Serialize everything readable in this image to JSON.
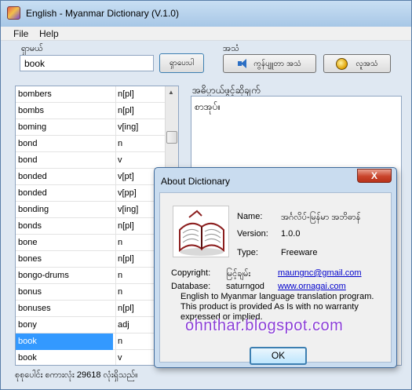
{
  "window": {
    "title": "English - Myanmar Dictionary (V.1.0)"
  },
  "menu": {
    "file": "File",
    "help": "Help"
  },
  "search": {
    "group_label": "ရှာမယ်",
    "value": "book",
    "button_label": "ရှာပေးပါ"
  },
  "sound": {
    "group_label": "အသံ",
    "speak_button_label": "ကွန်ပျူတာ အသံ",
    "human_button_label": "လူအသံ"
  },
  "meaning": {
    "label": "အဓိပ္ပာယ်ဖွင့်ဆိုချက်",
    "text": "စာအုပ်။"
  },
  "word_list": {
    "rows": [
      {
        "word": "bombers",
        "pos": "n[pl]"
      },
      {
        "word": "bombs",
        "pos": "n[pl]"
      },
      {
        "word": "boming",
        "pos": "v[ing]"
      },
      {
        "word": "bond",
        "pos": "n"
      },
      {
        "word": "bond",
        "pos": "v"
      },
      {
        "word": "bonded",
        "pos": "v[pt]"
      },
      {
        "word": "bonded",
        "pos": "v[pp]"
      },
      {
        "word": "bonding",
        "pos": "v[ing]"
      },
      {
        "word": "bonds",
        "pos": "n[pl]"
      },
      {
        "word": "bone",
        "pos": "n"
      },
      {
        "word": "bones",
        "pos": "n[pl]"
      },
      {
        "word": "bongo-drums",
        "pos": "n"
      },
      {
        "word": "bonus",
        "pos": "n"
      },
      {
        "word": "bonuses",
        "pos": "n[pl]"
      },
      {
        "word": "bony",
        "pos": "adj"
      },
      {
        "word": "book",
        "pos": "n"
      },
      {
        "word": "book",
        "pos": "v"
      }
    ],
    "selected_index": 15
  },
  "status_bar": {
    "text": "စုစုပေါင်း စကားလုံး  29618 လုံးရှိသည်။"
  },
  "about": {
    "title": "About Dictionary",
    "close_label": "X",
    "name_label": "Name:",
    "name_value": "အင်္ဂလိပ်-မြန်မာ အဘိဓာန်",
    "version_label": "Version:",
    "version_value": "1.0.0",
    "type_label": "Type:",
    "type_value": "Freeware",
    "copyright_label": "Copyright:",
    "copyright_value": "မြင့်ချမ်း",
    "copyright_email": "maungnc@gmail.com",
    "database_label": "Database:",
    "database_value": "saturngod",
    "database_url": "www.ornagai.com",
    "description_lines": [
      "English to Myanmar language translation program.",
      "This product is provided As Is with no warranty",
      "expressed or implied."
    ],
    "ok_label": "OK"
  },
  "watermark": "ohnthar.blogspot.com",
  "colors": {
    "selection": "#3399ff",
    "link": "#0000cc",
    "watermark": "#8b3fd6",
    "close_button": "#c9442b"
  }
}
